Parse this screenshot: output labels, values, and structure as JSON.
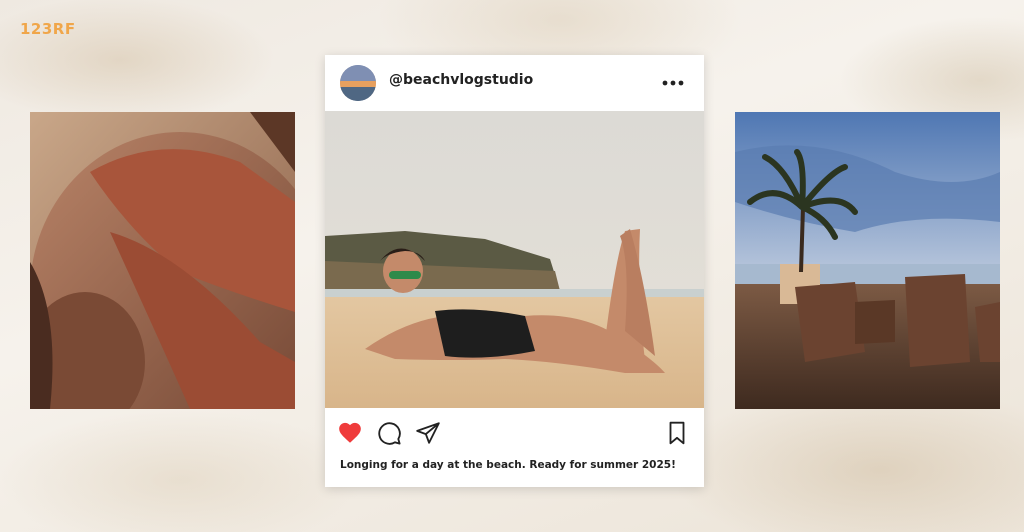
{
  "watermark": {
    "text": "123RF"
  },
  "post": {
    "username": "@beachvlogstudio",
    "caption": "Longing for a day at the beach. Ready for summer 2025!",
    "liked": true,
    "icons": {
      "more": "more-horizontal-icon",
      "like": "heart-icon",
      "comment": "comment-icon",
      "share": "send-icon",
      "save": "bookmark-icon"
    }
  },
  "colors": {
    "like": "#ef3b3b",
    "watermark": "#f0a64a",
    "card": "#ffffff",
    "text": "#222222"
  }
}
